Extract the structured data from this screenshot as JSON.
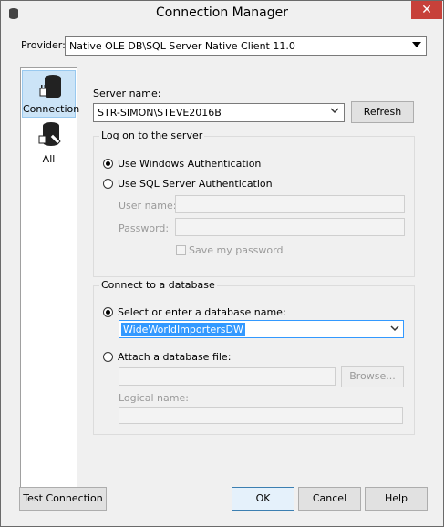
{
  "window": {
    "title": "Connection Manager",
    "close_glyph": "✕"
  },
  "provider": {
    "label": "Provider:",
    "value": "Native OLE DB\\SQL Server Native Client 11.0"
  },
  "sidebar": {
    "items": [
      {
        "label": "Connection",
        "icon": "database-plug-icon",
        "selected": true
      },
      {
        "label": "All",
        "icon": "database-wrench-icon",
        "selected": false
      }
    ]
  },
  "server": {
    "label": "Server name:",
    "value": "STR-SIMON\\STEVE2016B",
    "refresh_label": "Refresh"
  },
  "logon": {
    "group_title": "Log on to the server",
    "windows_auth_label": "Use Windows Authentication",
    "sql_auth_label": "Use SQL Server Authentication",
    "username_label": "User name:",
    "password_label": "Password:",
    "save_password_label": "Save my password"
  },
  "database": {
    "group_title": "Connect to a database",
    "select_label": "Select or enter a database name:",
    "selected_db": "WideWorldImportersDW",
    "attach_label": "Attach a database file:",
    "browse_label": "Browse...",
    "logical_name_label": "Logical name:"
  },
  "footer": {
    "test_label": "Test Connection",
    "ok_label": "OK",
    "cancel_label": "Cancel",
    "help_label": "Help"
  }
}
